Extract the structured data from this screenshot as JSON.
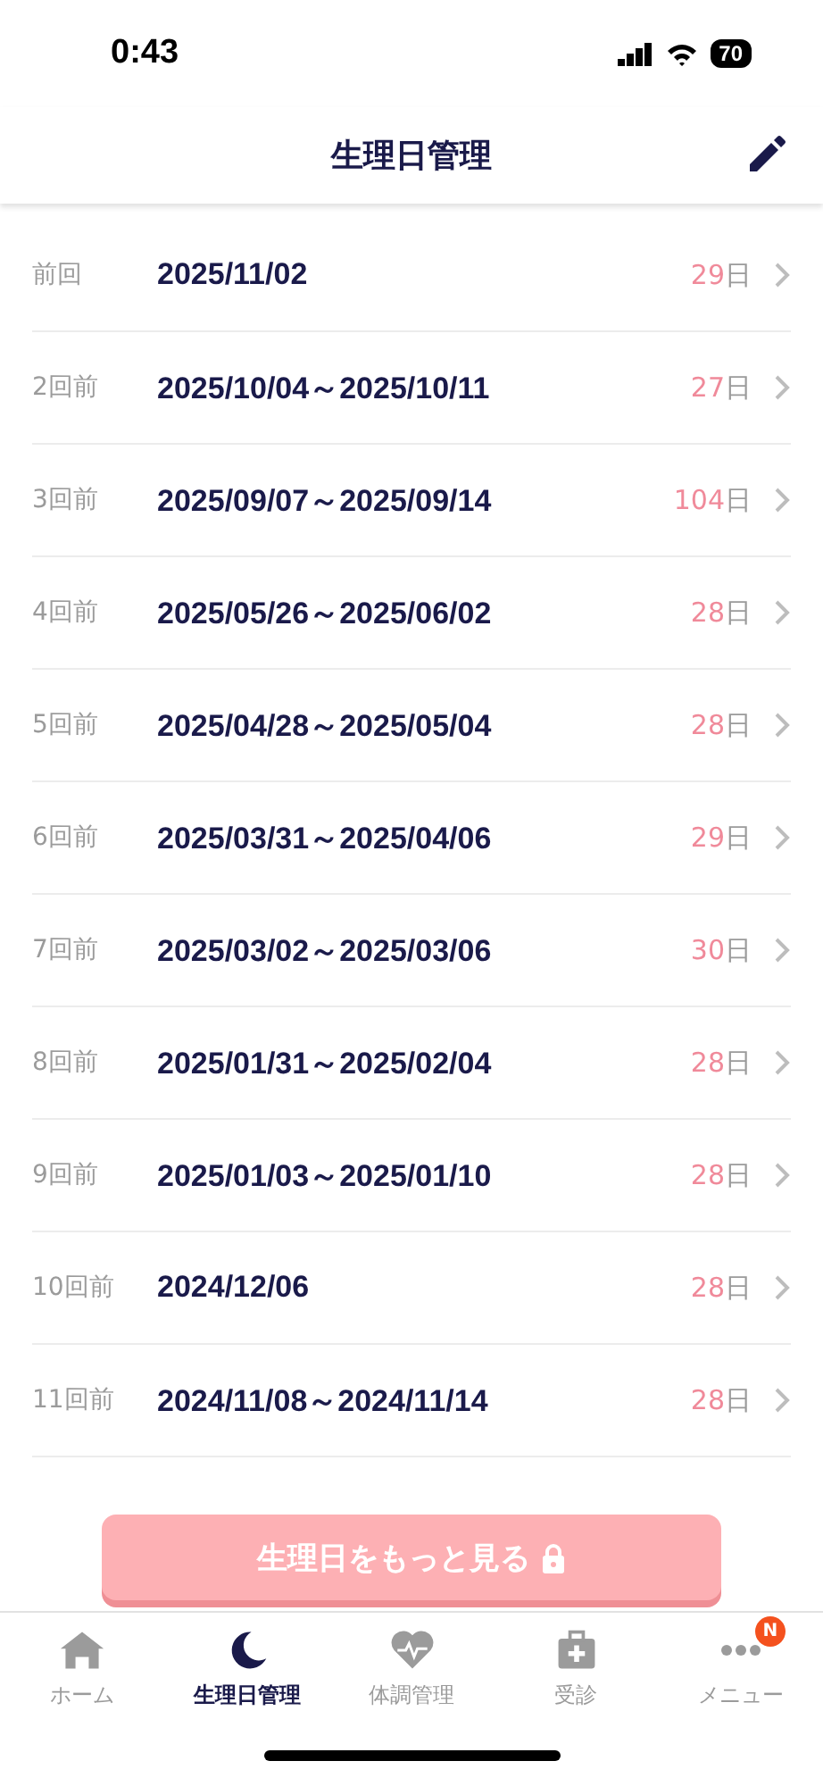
{
  "status_bar": {
    "time": "0:43",
    "battery": "70"
  },
  "header": {
    "title": "生理日管理"
  },
  "rows": [
    {
      "label": "前回",
      "dates": "2025/11/02",
      "days": "29",
      "unit": "日"
    },
    {
      "label": "2回前",
      "dates": "2025/10/04～2025/10/11",
      "days": "27",
      "unit": "日"
    },
    {
      "label": "3回前",
      "dates": "2025/09/07～2025/09/14",
      "days": "104",
      "unit": "日"
    },
    {
      "label": "4回前",
      "dates": "2025/05/26～2025/06/02",
      "days": "28",
      "unit": "日"
    },
    {
      "label": "5回前",
      "dates": "2025/04/28～2025/05/04",
      "days": "28",
      "unit": "日"
    },
    {
      "label": "6回前",
      "dates": "2025/03/31～2025/04/06",
      "days": "29",
      "unit": "日"
    },
    {
      "label": "7回前",
      "dates": "2025/03/02～2025/03/06",
      "days": "30",
      "unit": "日"
    },
    {
      "label": "8回前",
      "dates": "2025/01/31～2025/02/04",
      "days": "28",
      "unit": "日"
    },
    {
      "label": "9回前",
      "dates": "2025/01/03～2025/01/10",
      "days": "28",
      "unit": "日"
    },
    {
      "label": "10回前",
      "dates": "2024/12/06",
      "days": "28",
      "unit": "日"
    },
    {
      "label": "11回前",
      "dates": "2024/11/08～2024/11/14",
      "days": "28",
      "unit": "日"
    }
  ],
  "more_button": {
    "label": "生理日をもっと見る"
  },
  "tabs": [
    {
      "kind": "home",
      "label": "ホーム",
      "selected": false
    },
    {
      "kind": "moon",
      "label": "生理日管理",
      "selected": true
    },
    {
      "kind": "heart",
      "label": "体調管理",
      "selected": false
    },
    {
      "kind": "clinic",
      "label": "受診",
      "selected": false
    },
    {
      "kind": "menu",
      "label": "メニュー",
      "selected": false,
      "badge": "N"
    }
  ]
}
